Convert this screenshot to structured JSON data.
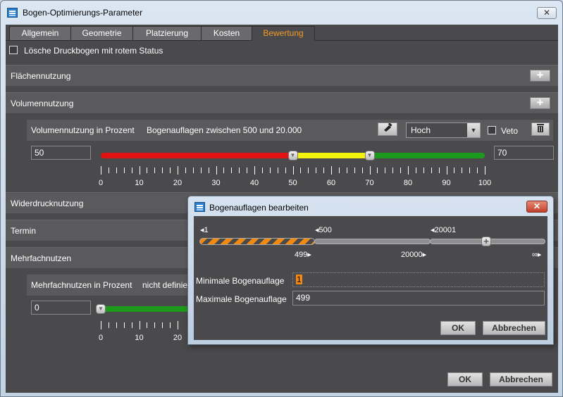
{
  "window": {
    "title": "Bogen-Optimierungs-Parameter",
    "close_glyph": "✕"
  },
  "tabs": [
    "Allgemein",
    "Geometrie",
    "Platzierung",
    "Kosten",
    "Bewertung"
  ],
  "active_tab": "Bewertung",
  "delete_red": {
    "label": "Lösche Druckbogen mit rotem Status",
    "checked": false
  },
  "sections": {
    "flaeche": "Flächennutzung",
    "volumen": "Volumennutzung",
    "widerdruck": "Widerdrucknutzung",
    "termin": "Termin",
    "mehrfach": "Mehrfachnutzen"
  },
  "volumen_row": {
    "label": "Volumennutzung in Prozent",
    "range": "Bogenauflagen zwischen 500 und 20.000",
    "priority": "Hoch",
    "veto_label": "Veto",
    "veto_checked": false,
    "low_value": "50",
    "high_value": "70",
    "low": 50,
    "high": 70,
    "colors": {
      "low": "#e21212",
      "mid": "#f2f20a",
      "high": "#1d9a1d"
    },
    "tick_labels": [
      "0",
      "10",
      "20",
      "30",
      "40",
      "50",
      "60",
      "70",
      "80",
      "90",
      "100"
    ]
  },
  "mehrfach_row": {
    "label": "Mehrfachnutzen in Prozent",
    "range": "nicht definie",
    "low_value": "0",
    "tick_labels": [
      "0",
      "10",
      "20"
    ]
  },
  "buttons": {
    "ok": "OK",
    "cancel": "Abbrechen"
  },
  "sub_dialog": {
    "title": "Bogenauflagen bearbeiten",
    "close_glyph": "✕",
    "top_markers": [
      "◂1",
      "◂500",
      "◂20001"
    ],
    "bottom_markers": [
      "499▸",
      "20000▸",
      "∞▸"
    ],
    "min_label": "Minimale Bogenauflage",
    "min_value": "1",
    "max_label": "Maximale Bogenauflage",
    "max_value": "499",
    "ok": "OK",
    "cancel": "Abbrechen"
  }
}
